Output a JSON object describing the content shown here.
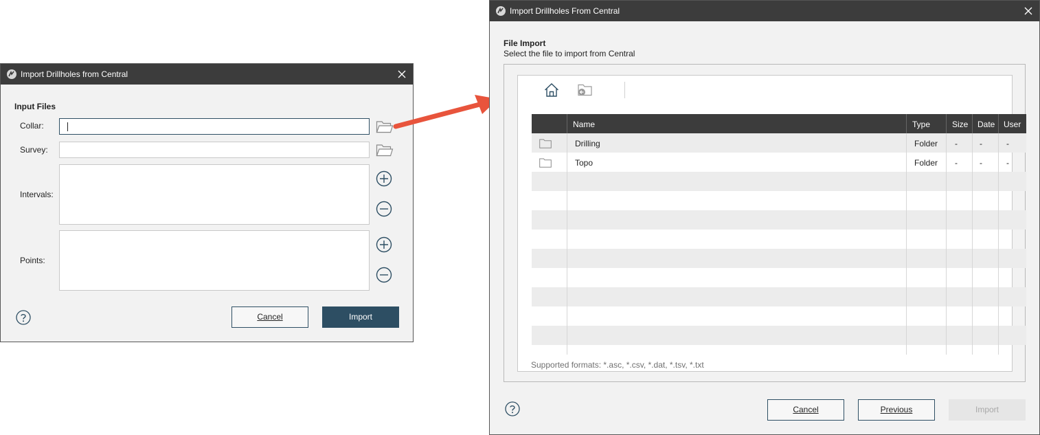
{
  "left_dialog": {
    "title": "Import Drillholes from Central",
    "section_title": "Input Files",
    "collar_label": "Collar:",
    "survey_label": "Survey:",
    "intervals_label": "Intervals:",
    "points_label": "Points:",
    "collar_value": "",
    "survey_value": "",
    "cancel_label": "Cancel",
    "import_label": "Import"
  },
  "right_dialog": {
    "title": "Import Drillholes From Central",
    "section_title": "File Import",
    "section_subtitle": "Select the file to import from Central",
    "columns": [
      "Name",
      "Type",
      "Size",
      "Date",
      "User"
    ],
    "rows": [
      {
        "name": "Drilling",
        "type": "Folder",
        "size": "-",
        "date": "-",
        "user": "-",
        "icon": "folder-icon"
      },
      {
        "name": "Topo",
        "type": "Folder",
        "size": "-",
        "date": "-",
        "user": "-",
        "icon": "folder-icon"
      }
    ],
    "supported_formats": "Supported formats: *.asc, *.csv, *.dat, *.tsv, *.txt",
    "cancel_label": "Cancel",
    "previous_label": "Previous",
    "import_label": "Import"
  },
  "colors": {
    "titlebar": "#3c3c3c",
    "accent": "#2d4e63",
    "arrow": "#e8543c",
    "dialog_bg": "#f2f2f2"
  }
}
